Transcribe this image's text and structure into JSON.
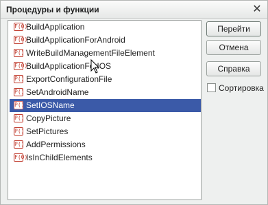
{
  "window": {
    "title": "Процедуры и функции",
    "close_glyph": "✕"
  },
  "list": {
    "items": [
      {
        "icon": "function-icon",
        "icon_text": "F(0)",
        "label": "BuildApplication",
        "selected": false
      },
      {
        "icon": "function-icon",
        "icon_text": "F(0)",
        "label": "BuildApplicationForAndroid",
        "selected": false
      },
      {
        "icon": "procedure-icon",
        "icon_text": "P()",
        "label": "WriteBuildManagementFileElement",
        "selected": false
      },
      {
        "icon": "function-icon",
        "icon_text": "F(0)",
        "label": "BuildApplicationForIOS",
        "selected": false
      },
      {
        "icon": "procedure-icon",
        "icon_text": "P()",
        "label": "ExportConfigurationFile",
        "selected": false
      },
      {
        "icon": "procedure-icon",
        "icon_text": "P()",
        "label": "SetAndroidName",
        "selected": false
      },
      {
        "icon": "procedure-icon",
        "icon_text": "P()",
        "label": "SetIOSName",
        "selected": true
      },
      {
        "icon": "procedure-icon",
        "icon_text": "P()",
        "label": "CopyPicture",
        "selected": false
      },
      {
        "icon": "procedure-icon",
        "icon_text": "P()",
        "label": "SetPictures",
        "selected": false
      },
      {
        "icon": "procedure-icon",
        "icon_text": "P()",
        "label": "AddPermissions",
        "selected": false
      },
      {
        "icon": "function-icon",
        "icon_text": "F(0)",
        "label": "IsInChildElements",
        "selected": false
      }
    ]
  },
  "buttons": {
    "goto": "Перейти",
    "cancel": "Отмена",
    "help": "Справка"
  },
  "sort": {
    "label": "Сортировка",
    "checked": false
  },
  "colors": {
    "selection": "#3b5aa8",
    "icon_red": "#c0392b"
  }
}
